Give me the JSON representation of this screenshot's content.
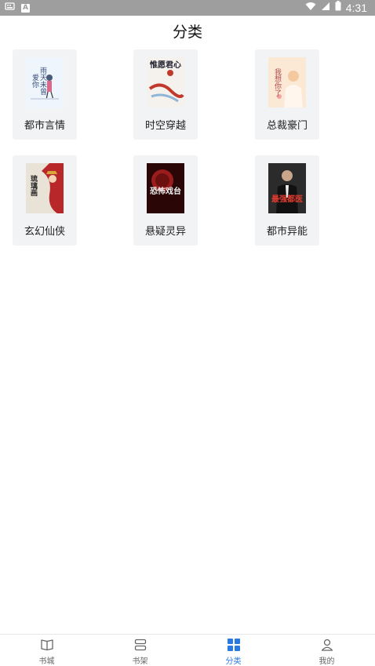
{
  "status_bar": {
    "time": "4:31",
    "notification_badge": "A"
  },
  "header": {
    "title": "分类"
  },
  "categories": [
    {
      "label": "都市言情",
      "cover_text": "雨天未曾爱你",
      "cover_color": "#eaf2fb"
    },
    {
      "label": "时空穿越",
      "cover_text": "惟愿君心",
      "cover_color": "#f7f4ef"
    },
    {
      "label": "总裁豪门",
      "cover_text": "我想你了",
      "cover_color": "#fbe9d8"
    },
    {
      "label": "玄幻仙侠",
      "cover_text": "琉璃画",
      "cover_color": "#c0392b"
    },
    {
      "label": "悬疑灵异",
      "cover_text": "恐怖戏台",
      "cover_color": "#3b0a0a"
    },
    {
      "label": "都市异能",
      "cover_text": "最强都医",
      "cover_color": "#1c1c1c"
    }
  ],
  "tab_bar": {
    "items": [
      {
        "label": "书城",
        "icon": "book-open-icon"
      },
      {
        "label": "书架",
        "icon": "bookshelf-icon"
      },
      {
        "label": "分类",
        "icon": "grid-icon"
      },
      {
        "label": "我的",
        "icon": "user-icon"
      }
    ],
    "active_index": 2,
    "active_color": "#2a7ae2"
  }
}
